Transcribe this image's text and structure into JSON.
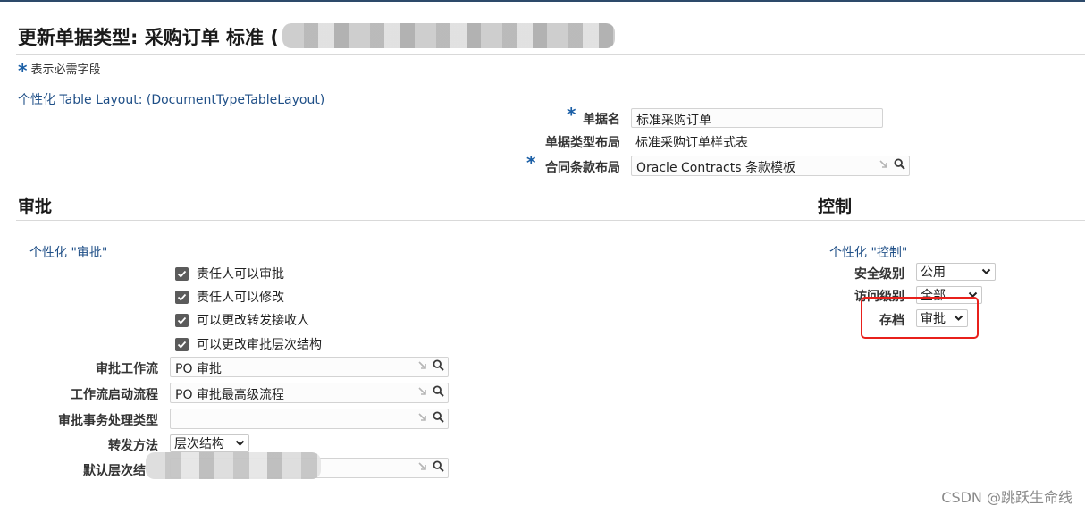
{
  "page": {
    "title": "更新单据类型: 采购订单 标准 (",
    "required_star": "*",
    "required_note": "表示必需字段",
    "personalize_table_link": "个性化 Table Layout: (DocumentTypeTableLayout)"
  },
  "header_fields": {
    "doc_name_label": "单据名",
    "doc_name_value": "标准采购订单",
    "layout_label": "单据类型布局",
    "layout_value": "标准采购订单样式表",
    "contract_label": "合同条款布局",
    "contract_value": "Oracle Contracts 条款模板"
  },
  "approval": {
    "heading": "审批",
    "personalize_link": "个性化 \"审批\"",
    "checkboxes": [
      {
        "label": "责任人可以审批",
        "checked": true
      },
      {
        "label": "责任人可以修改",
        "checked": true
      },
      {
        "label": "可以更改转发接收人",
        "checked": true
      },
      {
        "label": "可以更改审批层次结构",
        "checked": true
      }
    ],
    "workflow_label": "审批工作流",
    "workflow_value": "PO 审批",
    "start_process_label": "工作流启动流程",
    "start_process_value": "PO 审批最高级流程",
    "txn_type_label": "审批事务处理类型",
    "txn_type_value": "",
    "forward_method_label": "转发方法",
    "forward_method_value": "层次结构",
    "default_hierarchy_label": "默认层次结",
    "default_hierarchy_value": ""
  },
  "control": {
    "heading": "控制",
    "personalize_link": "个性化 \"控制\"",
    "security_label": "安全级别",
    "security_value": "公用",
    "access_label": "访问级别",
    "access_value": "全部",
    "archive_label": "存档",
    "archive_value": "审批"
  },
  "watermark": "CSDN @跳跃生命线",
  "colors": {
    "link": "#1f4f87",
    "required_star": "#1b5fa6",
    "highlight": "#e8201b"
  },
  "icons": [
    "search-icon",
    "clear-icon",
    "chevron-down-icon",
    "checkmark-icon"
  ]
}
